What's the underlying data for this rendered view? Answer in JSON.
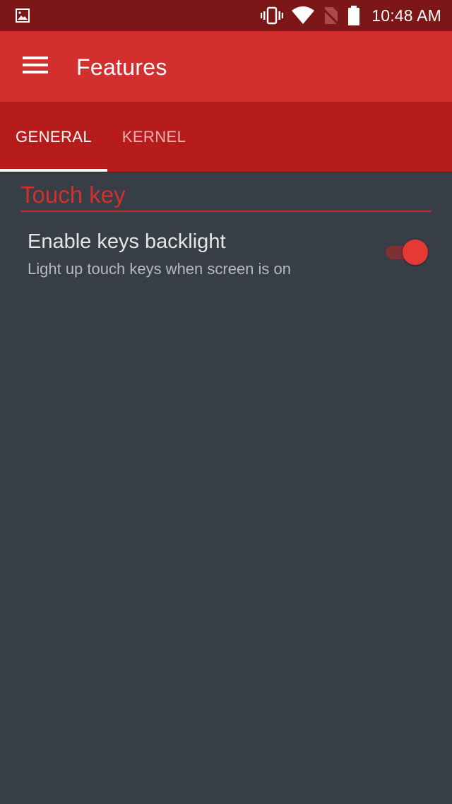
{
  "status_bar": {
    "time": "10:48 AM",
    "icons": [
      "image-notification-icon",
      "vibrate-icon",
      "wifi-icon",
      "no-sim-icon",
      "battery-icon"
    ]
  },
  "app_bar": {
    "title": "Features",
    "menu_icon": "hamburger-menu-icon"
  },
  "tabs": [
    {
      "label": "GENERAL",
      "selected": true
    },
    {
      "label": "KERNEL",
      "selected": false
    }
  ],
  "sections": [
    {
      "header": "Touch key",
      "items": [
        {
          "title": "Enable keys backlight",
          "summary": "Light up touch keys when screen is on",
          "enabled": true
        }
      ]
    }
  ],
  "colors": {
    "primary": "#d32f2f",
    "primary_dark": "#7d1616",
    "tab_bar": "#b71c1c",
    "background": "#383e45",
    "accent": "#e53935"
  }
}
